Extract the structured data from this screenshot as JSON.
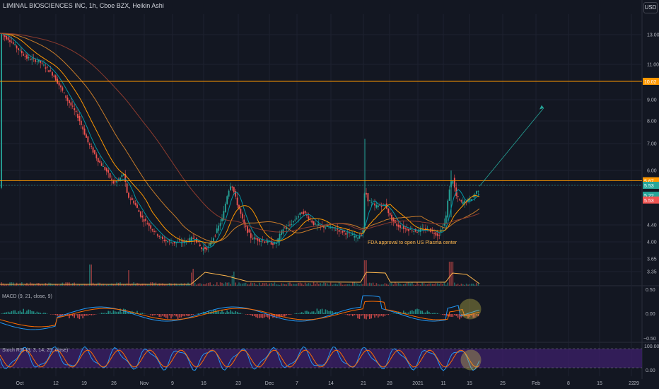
{
  "header": {
    "title": "LIMINAL BIOSCIENCES INC, 1h, Cboe BZX, Heikin Ashi",
    "currency_badge": "USD"
  },
  "colors": {
    "bg": "#131722",
    "grid": "#1e2230",
    "up": "#26a69a",
    "down": "#ef5350",
    "ma_fast": "#0097a7",
    "ma_orange": "#ff9800",
    "ma_red": "#8d3b2e",
    "ma_brown": "#a0522d",
    "level_line": "#ff9800",
    "macd_line": "#2196f3",
    "signal_line": "#ff6d00",
    "rsi_k": "#2196f3",
    "rsi_d": "#ff6d00",
    "rsi_band": "#2a1a4a",
    "highlight": "#d4c84a"
  },
  "price_axis": {
    "labels": [
      "13.00",
      "11.00",
      "10.02",
      "9.00",
      "8.00",
      "7.00",
      "6.00",
      "5.67",
      "5.53",
      "5.22",
      "5.53",
      "4.40",
      "4.00",
      "3.65",
      "3.35"
    ],
    "tags": [
      {
        "text": "10.02",
        "value": 10.02,
        "color": "#ff9800"
      },
      {
        "text": "5.67",
        "value": 5.67,
        "color": "#ff9800"
      },
      {
        "text": "5.53",
        "value": 5.53,
        "color": "#26a69a"
      },
      {
        "text": "5.22",
        "value": 5.22,
        "color": "#26a69a"
      },
      {
        "text": "5.53",
        "value": 5.08,
        "color": "#ef5350"
      }
    ]
  },
  "time_axis": {
    "labels": [
      "Oct",
      "12",
      "19",
      "26",
      "Nov",
      "9",
      "16",
      "23",
      "Dec",
      "7",
      "14",
      "21",
      "28",
      "2021",
      "11",
      "15",
      "25",
      "Feb",
      "8",
      "15",
      "22",
      "29"
    ]
  },
  "annotation": {
    "text": "FDA approval to open US Plasma center"
  },
  "macd": {
    "title": "MACD (9, 21, close, 9)",
    "axis_labels": [
      "0.50",
      "0.00",
      "−0.50"
    ]
  },
  "stoch_rsi": {
    "title": "Stoch RSI (3, 3, 14, 25, close)",
    "axis_labels": [
      "100.00",
      "0.00"
    ]
  },
  "chart_data": {
    "type": "candlestick",
    "title": "LIMINAL BIOSCIENCES INC, 1h, Cboe BZX, Heikin Ashi",
    "y_scale": "log",
    "ylim": [
      3.1,
      14.0
    ],
    "x": [
      "Oct",
      "12",
      "19",
      "26",
      "Nov",
      "9",
      "16",
      "23",
      "Dec",
      "7",
      "14",
      "21",
      "28",
      "2021",
      "11",
      "15",
      "25",
      "Feb",
      "8",
      "15",
      "22",
      "29"
    ],
    "close_approx": [
      12.8,
      11.5,
      9.4,
      6.6,
      5.2,
      4.2,
      3.95,
      5.0,
      4.05,
      4.55,
      4.3,
      5.2,
      4.6,
      4.35,
      4.5,
      5.4
    ],
    "horizontal_levels": [
      10.02,
      5.67,
      5.53
    ],
    "projection": {
      "from": 5.5,
      "to": 8.6
    },
    "spikes": [
      {
        "label": "21",
        "high": 7.2
      },
      {
        "label": "11",
        "high": 6.0
      }
    ],
    "volume_note": "volume bars with moving average",
    "grid": true,
    "legend": "none"
  }
}
